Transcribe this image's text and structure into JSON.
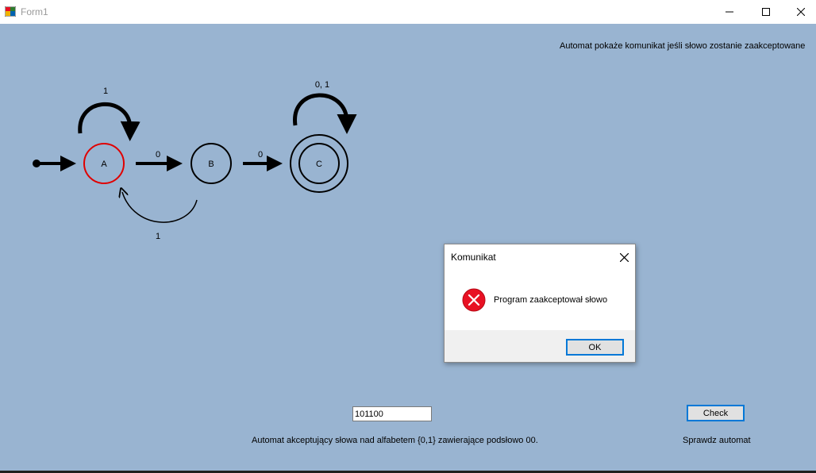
{
  "window": {
    "title": "Form1",
    "icon": "winforms-app-icon"
  },
  "info_label": "Automat pokaże komunikat jeśli słowo zostanie zaakceptowane",
  "automaton": {
    "states": [
      {
        "name": "A",
        "initial": true,
        "accepting": false,
        "highlighted": true
      },
      {
        "name": "B",
        "initial": false,
        "accepting": false,
        "highlighted": false
      },
      {
        "name": "C",
        "initial": false,
        "accepting": true,
        "highlighted": false
      }
    ],
    "transitions": [
      {
        "from": "A",
        "to": "A",
        "label": "1"
      },
      {
        "from": "A",
        "to": "B",
        "label": "0"
      },
      {
        "from": "B",
        "to": "A",
        "label": "1"
      },
      {
        "from": "B",
        "to": "C",
        "label": "0"
      },
      {
        "from": "C",
        "to": "C",
        "label": "0, 1"
      }
    ],
    "highlight_color": "#e00000"
  },
  "word_input": {
    "value": "101100"
  },
  "check_button": {
    "label": "Check"
  },
  "description_label": "Automat akceptujący słowa nad alfabetem {0,1} zawierające podsłowo 00.",
  "check_label": "Sprawdz automat",
  "message_box": {
    "title": "Komunikat",
    "text": "Program zaakceptował słowo",
    "icon": "error-icon",
    "ok_label": "OK"
  },
  "colors": {
    "background": "#99b4d1",
    "accent": "#0078d7",
    "error_icon": "#e81123"
  }
}
